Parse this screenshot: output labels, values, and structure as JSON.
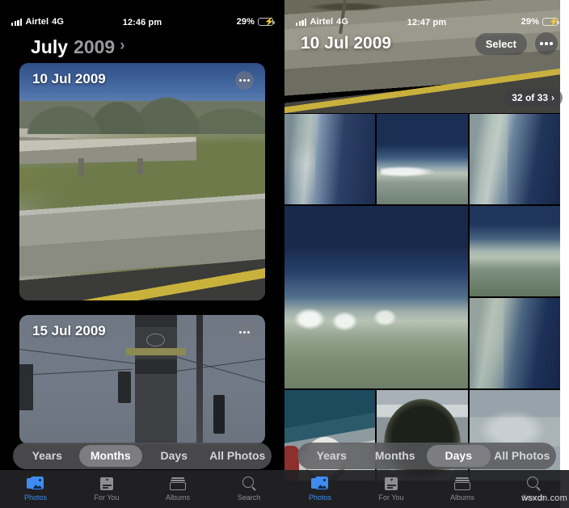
{
  "app": {
    "name": "Photos",
    "watermark": "wsxdn.com"
  },
  "left_screen": {
    "status_bar": {
      "carrier": "Airtel",
      "network": "4G",
      "time": "12:46 pm",
      "battery_percent": "29%",
      "signal_icon": "cellular-bars-icon",
      "battery_icon": "battery-charging-low-power-icon"
    },
    "header": {
      "month": "July",
      "year": "2009",
      "chevron": "›"
    },
    "cards": [
      {
        "title": "10 Jul 2009",
        "more_icon": "ellipsis-icon",
        "photo": "highway-overpass-mountains"
      },
      {
        "title": "15 Jul 2009",
        "more_icon": "ellipsis-icon",
        "photo": "clock-tower-wires"
      }
    ],
    "segmented": {
      "options": [
        "Years",
        "Months",
        "Days",
        "All Photos"
      ],
      "selected": "Months"
    },
    "tabs": [
      {
        "label": "Photos",
        "icon": "photos-icon",
        "active": true
      },
      {
        "label": "For You",
        "icon": "for-you-icon",
        "active": false
      },
      {
        "label": "Albums",
        "icon": "albums-icon",
        "active": false
      },
      {
        "label": "Search",
        "icon": "search-icon",
        "active": false
      }
    ]
  },
  "right_screen": {
    "status_bar": {
      "carrier": "Airtel",
      "network": "4G",
      "time": "12:47 pm",
      "battery_percent": "29%",
      "signal_icon": "cellular-bars-icon",
      "battery_icon": "battery-charging-low-power-icon"
    },
    "header": {
      "title": "10 Jul 2009",
      "select_label": "Select",
      "more_icon": "ellipsis-icon"
    },
    "count_badge": {
      "text": "32 of 33",
      "chevron": "›"
    },
    "grid_photos": [
      "aerial-sky-horizon-1",
      "aerial-clouds-land",
      "aerial-sky-horizon-2",
      "aerial-earth-curvature-large",
      "aerial-coastline",
      "aerial-sky-limb",
      "food-plate-on-tray",
      "dark-round-dish",
      "hazy-cloud-layer"
    ],
    "segmented": {
      "options": [
        "Years",
        "Months",
        "Days",
        "All Photos"
      ],
      "selected": "Days"
    },
    "tabs": [
      {
        "label": "Photos",
        "icon": "photos-icon",
        "active": true
      },
      {
        "label": "For You",
        "icon": "for-you-icon",
        "active": false
      },
      {
        "label": "Albums",
        "icon": "albums-icon",
        "active": false
      },
      {
        "label": "Search",
        "icon": "search-icon",
        "active": false
      }
    ]
  },
  "colors": {
    "accent": "#3e8cf0",
    "inactive": "#8e8e93",
    "battery": "#f5c518",
    "background": "#000000"
  }
}
